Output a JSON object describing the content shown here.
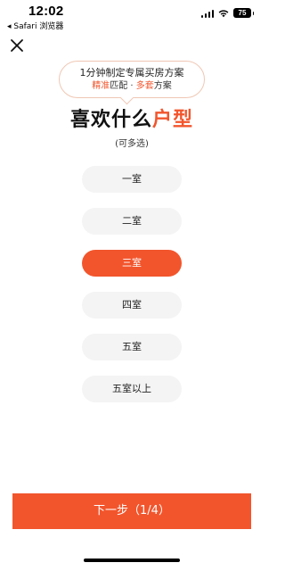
{
  "status_bar": {
    "time": "12:02",
    "back_label": "◂ Safari 浏览器",
    "battery": "75"
  },
  "bubble": {
    "line1": "1分钟制定专属买房方案",
    "line2_part1": "精准",
    "line2_part2": "匹配 · ",
    "line2_part3": "多套",
    "line2_part4": "方案"
  },
  "title": {
    "main": "喜欢什么",
    "highlight": "户型"
  },
  "subtitle": "(可多选)",
  "options": [
    {
      "label": "一室",
      "selected": false
    },
    {
      "label": "二室",
      "selected": false
    },
    {
      "label": "三室",
      "selected": true
    },
    {
      "label": "四室",
      "selected": false
    },
    {
      "label": "五室",
      "selected": false
    },
    {
      "label": "五室以上",
      "selected": false
    }
  ],
  "next_button": {
    "label": "下一步（1/4）"
  },
  "colors": {
    "accent": "#f2552c"
  },
  "icons": {
    "close": "close-icon",
    "wifi": "wifi-icon",
    "signal": "signal-icon",
    "battery": "battery-icon"
  }
}
